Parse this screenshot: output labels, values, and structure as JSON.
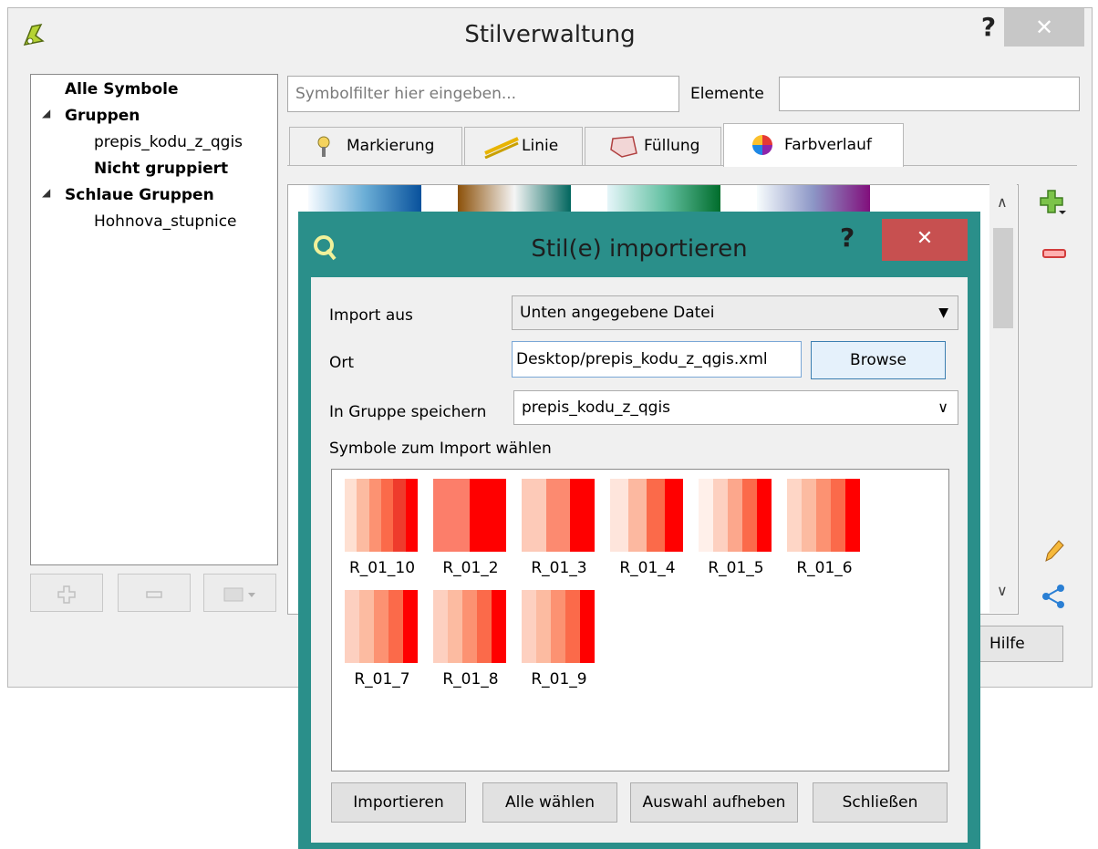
{
  "main_window": {
    "title": "Stilverwaltung",
    "help": "?",
    "close": "✕",
    "tree": {
      "all_symbols": "Alle Symbole",
      "groups_label": "Gruppen",
      "groups": [
        "prepis_kodu_z_qgis",
        "Nicht gruppiert"
      ],
      "smart_groups_label": "Schlaue Gruppen",
      "smart_groups": [
        "Hohnova_stupnice"
      ],
      "expand_glyph": "◢"
    },
    "filter_placeholder": "Symbolfilter hier eingeben...",
    "elements_label": "Elemente",
    "elements_value": "",
    "tabs": [
      "Markierung",
      "Linie",
      "Füllung",
      "Farbverlauf"
    ],
    "active_tab": "Farbverlauf",
    "help_button": "Hilfe",
    "ramps": [
      [
        "#f7fbff",
        "#6baed6",
        "#08519c"
      ],
      [
        "#8c510a",
        "#f5f5f5",
        "#01665e"
      ],
      [
        "#e5f5f9",
        "#66c2a4",
        "#006d2c"
      ],
      [
        "#f7fcfd",
        "#8c96c6",
        "#810f7c"
      ]
    ]
  },
  "dialog": {
    "title": "Stil(e) importieren",
    "help": "?",
    "close": "✕",
    "import_from_label": "Import aus",
    "import_from_value": "Unten angegebene Datei",
    "location_label": "Ort",
    "location_value": "Desktop/prepis_kodu_z_qgis.xml",
    "browse_button": "Browse",
    "save_group_label": "In Gruppe speichern",
    "save_group_value": "prepis_kodu_z_qgis",
    "choose_label": "Symbole zum Import wählen",
    "symbols": [
      {
        "name": "R_01_10",
        "colors": [
          "#fee0d2",
          "#fcbba1",
          "#fc9272",
          "#fb6a4a",
          "#ef3b2c",
          "#ff0000"
        ]
      },
      {
        "name": "R_01_2",
        "colors": [
          "#fc7e6a",
          "#ff0000"
        ]
      },
      {
        "name": "R_01_3",
        "colors": [
          "#fdcab8",
          "#fc8a70",
          "#ff0000"
        ]
      },
      {
        "name": "R_01_4",
        "colors": [
          "#fee5dc",
          "#fcb8a0",
          "#fb6a4a",
          "#ff0000"
        ]
      },
      {
        "name": "R_01_5",
        "colors": [
          "#fff0ea",
          "#fdd0c0",
          "#fca78c",
          "#fb6a4a",
          "#ff0000"
        ]
      },
      {
        "name": "R_01_6",
        "colors": [
          "#fed6c6",
          "#fcbba1",
          "#fc9272",
          "#fb6a4a",
          "#ff0000"
        ]
      },
      {
        "name": "R_01_7",
        "colors": [
          "#fdd0c0",
          "#fcbba1",
          "#fc9272",
          "#fb6a4a",
          "#ff0000"
        ]
      },
      {
        "name": "R_01_8",
        "colors": [
          "#fdd0c0",
          "#fcbba1",
          "#fc9272",
          "#fb6a4a",
          "#ff0000"
        ]
      },
      {
        "name": "R_01_9",
        "colors": [
          "#fdd0c0",
          "#fcbba1",
          "#fc9272",
          "#fb6a4a",
          "#ff0000"
        ]
      }
    ],
    "buttons": {
      "import": "Importieren",
      "select_all": "Alle wählen",
      "deselect": "Auswahl aufheben",
      "close": "Schließen"
    }
  },
  "colors": {
    "dialog_frame": "#2a8f8a",
    "close_red": "#c75050"
  }
}
